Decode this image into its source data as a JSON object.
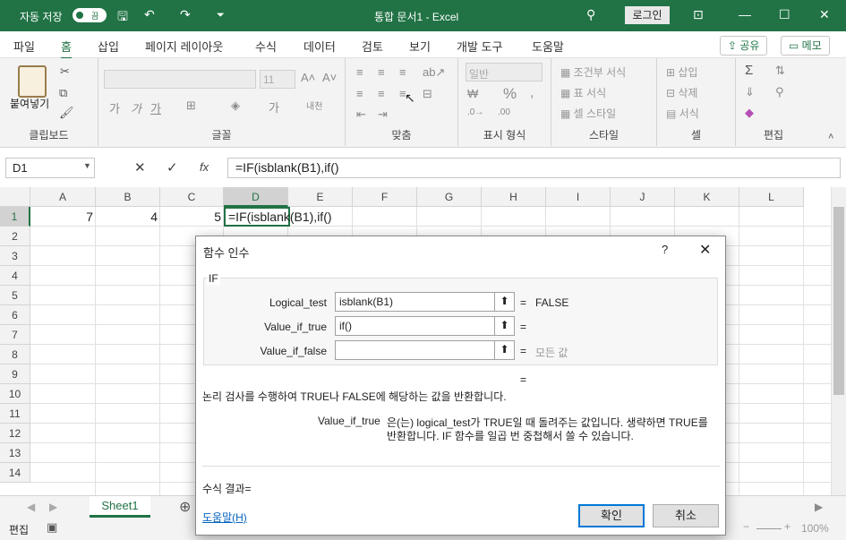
{
  "titlebar": {
    "autosave_label": "자동 저장",
    "autosave_state": "끔",
    "doc_title": "통합 문서1  -  Excel",
    "login": "로그인"
  },
  "menu": {
    "items": [
      "파일",
      "홈",
      "삽입",
      "페이지 레이아웃",
      "수식",
      "데이터",
      "검토",
      "보기",
      "개발 도구",
      "도움말"
    ],
    "share": "공유",
    "memo": "메모"
  },
  "ribbon": {
    "clipboard": {
      "paste": "붙여넣기",
      "label": "클립보드"
    },
    "font": {
      "size": "11",
      "label": "글꼴"
    },
    "align": {
      "label": "맞춤"
    },
    "number": {
      "format": "일반",
      "label": "표시 형식"
    },
    "styles": {
      "cond": "조건부 서식",
      "table": "표 서식",
      "cell": "셀 스타일",
      "label": "스타일"
    },
    "cells": {
      "insert": "삽입",
      "delete": "삭제",
      "format": "서식",
      "label": "셀"
    },
    "edit": {
      "label": "편집"
    }
  },
  "formula_bar": {
    "name_box": "D1",
    "formula": "=IF(isblank(B1),if()"
  },
  "grid": {
    "columns": [
      "A",
      "B",
      "C",
      "D",
      "E",
      "F",
      "G",
      "H",
      "I",
      "J",
      "K",
      "L"
    ],
    "rows": [
      "1",
      "2",
      "3",
      "4",
      "5",
      "6",
      "7",
      "8",
      "9",
      "10",
      "11",
      "12",
      "13",
      "14"
    ],
    "cells": {
      "A1": "7",
      "B1": "4",
      "C1": "5",
      "D1": "=IF(isblank(B1),if()"
    }
  },
  "sheet": {
    "tab": "Sheet1"
  },
  "status": {
    "mode": "편집",
    "zoom": "100%"
  },
  "dialog": {
    "title": "함수 인수",
    "help_q": "?",
    "function_name": "IF",
    "args": [
      {
        "label": "Logical_test",
        "value": "isblank(B1)",
        "result": "FALSE"
      },
      {
        "label": "Value_if_true",
        "value": "if()",
        "result": ""
      },
      {
        "label": "Value_if_false",
        "value": "",
        "result": "모든 값"
      }
    ],
    "eq": "=",
    "description": "논리 검사를 수행하여 TRUE나 FALSE에 해당하는 값을 반환합니다.",
    "arg_name": "Value_if_true",
    "arg_desc_1": "은(는) logical_test가 TRUE일 때 돌려주는 값입니다. 생략하면 TRUE를",
    "arg_desc_2": "반환합니다. IF 함수를 일곱 번 중첩해서 쓸 수 있습니다.",
    "result_label": "수식 결과=",
    "help_link": "도움말(H)",
    "ok": "확인",
    "cancel": "취소"
  }
}
